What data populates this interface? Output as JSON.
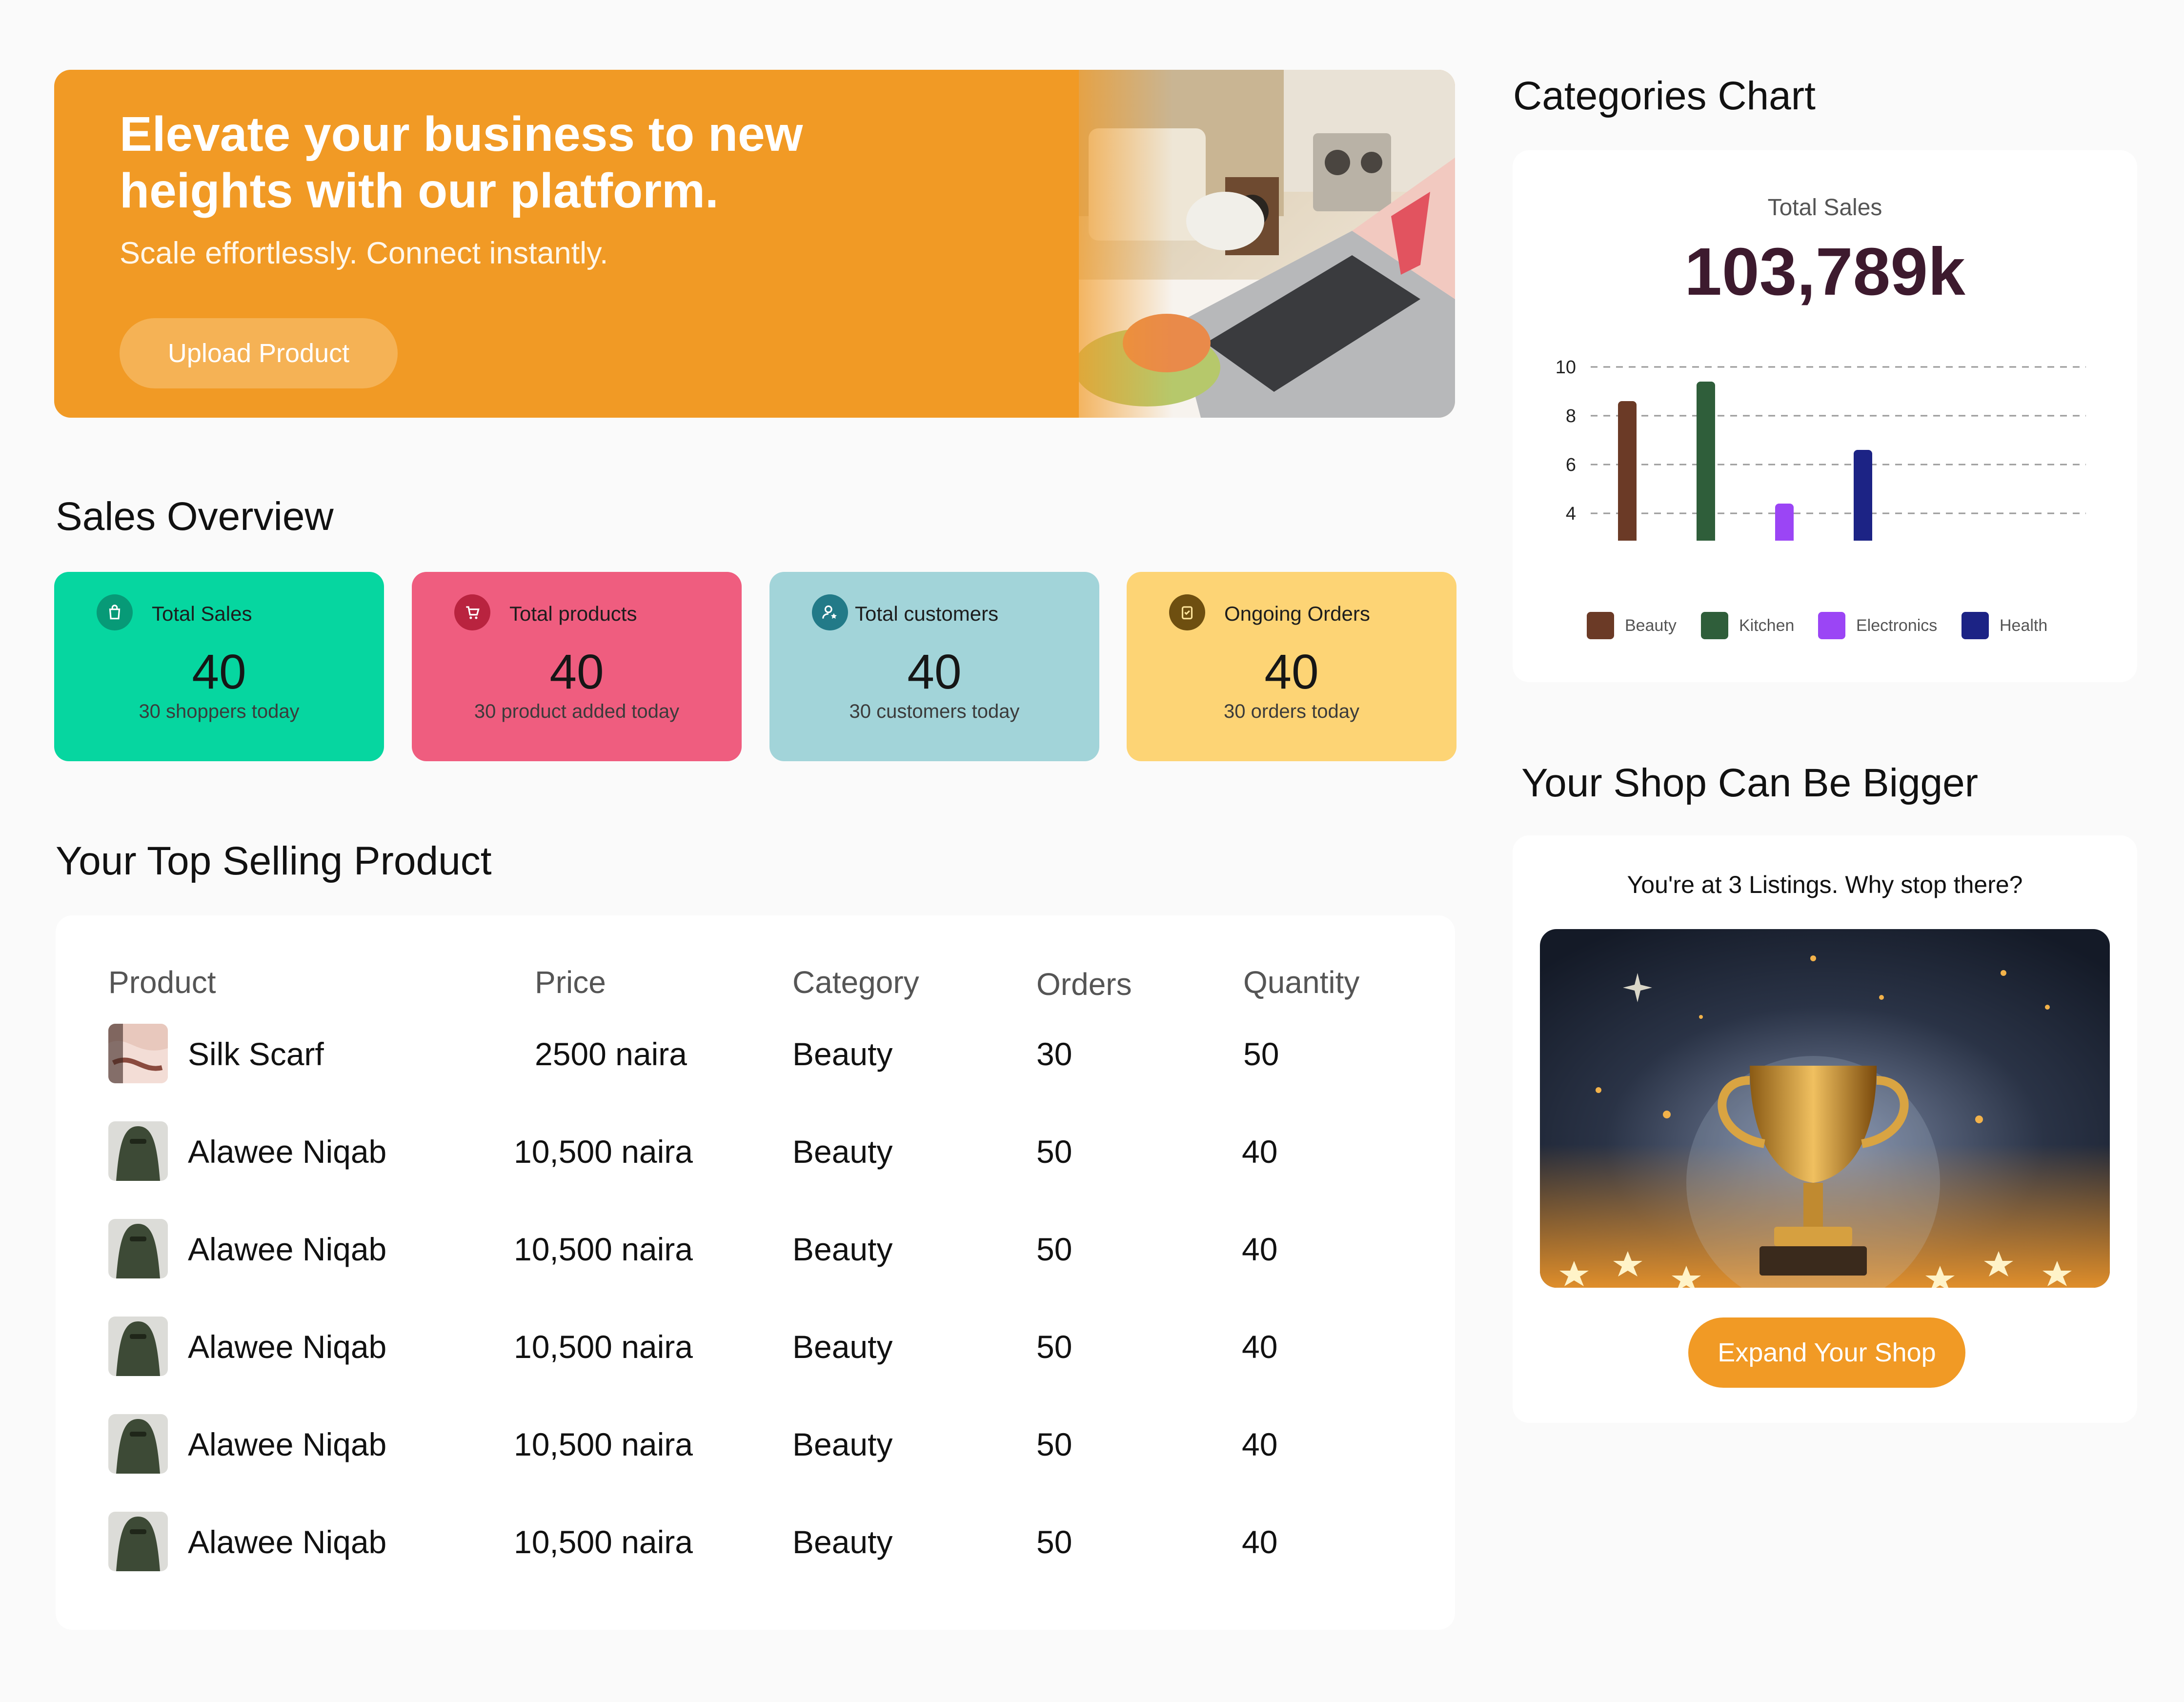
{
  "hero": {
    "title_line1": "Elevate your business to new",
    "title_line2": "heights with our platform.",
    "subtitle": "Scale effortlessly. Connect instantly.",
    "button": "Upload Product"
  },
  "sales_overview": {
    "title": "Sales Overview",
    "cards": [
      {
        "label": "Total Sales",
        "value": "40",
        "sub": "30 shoppers today",
        "color": "#06d6a0",
        "icon": "shopping-bag-icon"
      },
      {
        "label": "Total products",
        "value": "40",
        "sub": "30 product added today",
        "color": "#ef5d7f",
        "icon": "cart-icon"
      },
      {
        "label": "Total customers",
        "value": "40",
        "sub": "30 customers today",
        "color": "#a2d4d9",
        "icon": "user-star-icon"
      },
      {
        "label": "Ongoing Orders",
        "value": "40",
        "sub": "30 orders today",
        "color": "#fdd475",
        "icon": "clipboard-icon"
      }
    ]
  },
  "top_selling": {
    "title": "Your Top Selling Product",
    "headers": [
      "Product",
      "Price",
      "Category",
      "Orders",
      "Quantity"
    ],
    "rows": [
      {
        "product": "Silk Scarf",
        "price": "2500 naira",
        "category": "Beauty",
        "orders": "30",
        "quantity": "50"
      },
      {
        "product": "Alawee Niqab",
        "price": "10,500 naira",
        "category": "Beauty",
        "orders": "50",
        "quantity": "40"
      },
      {
        "product": "Alawee Niqab",
        "price": "10,500 naira",
        "category": "Beauty",
        "orders": "50",
        "quantity": "40"
      },
      {
        "product": "Alawee Niqab",
        "price": "10,500 naira",
        "category": "Beauty",
        "orders": "50",
        "quantity": "40"
      },
      {
        "product": "Alawee Niqab",
        "price": "10,500 naira",
        "category": "Beauty",
        "orders": "50",
        "quantity": "40"
      },
      {
        "product": "Alawee Niqab",
        "price": "10,500 naira",
        "category": "Beauty",
        "orders": "50",
        "quantity": "40"
      }
    ]
  },
  "categories_chart": {
    "heading": "Categories Chart",
    "label": "Total Sales",
    "total": "103,789k"
  },
  "chart_data": {
    "type": "bar",
    "categories": [
      "Beauty",
      "Kitchen",
      "Electronics",
      "Health"
    ],
    "values": [
      8.6,
      9.4,
      4.4,
      6.6
    ],
    "colors": [
      "#6b3a26",
      "#2f5e3a",
      "#9b45f5",
      "#1c2385"
    ],
    "yticks": [
      2,
      4,
      6,
      8,
      10
    ],
    "ylim": [
      2,
      10
    ],
    "grid": true,
    "legend": "bottom"
  },
  "promo": {
    "heading": "Your Shop Can Be Bigger",
    "text": "You're at 3 Listings. Why stop there?",
    "button": "Expand Your Shop"
  }
}
